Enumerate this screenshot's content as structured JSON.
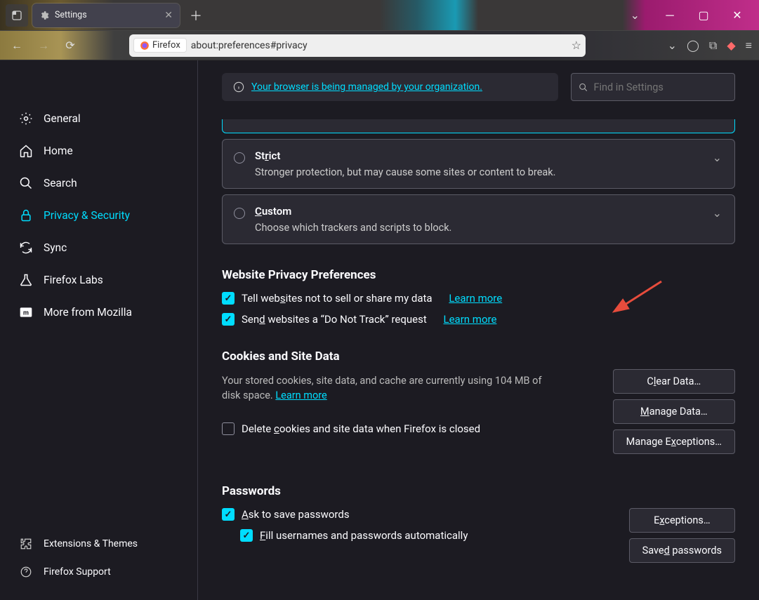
{
  "tab": {
    "title": "Settings"
  },
  "url": {
    "badge": "Firefox",
    "text": "about:preferences#privacy"
  },
  "banner": {
    "text": "Your browser is being managed by your organization."
  },
  "search": {
    "placeholder": "Find in Settings"
  },
  "sidebar": {
    "items": [
      {
        "label": "General"
      },
      {
        "label": "Home"
      },
      {
        "label": "Search"
      },
      {
        "label": "Privacy & Security"
      },
      {
        "label": "Sync"
      },
      {
        "label": "Firefox Labs"
      },
      {
        "label": "More from Mozilla"
      }
    ],
    "bottom": [
      {
        "label": "Extensions & Themes"
      },
      {
        "label": "Firefox Support"
      }
    ]
  },
  "tracking": {
    "strict": {
      "title_pre": "St",
      "title_u": "r",
      "title_post": "ict",
      "desc": "Stronger protection, but may cause some sites or content to break."
    },
    "custom": {
      "title_u": "C",
      "title_post": "ustom",
      "desc": "Choose which trackers and scripts to block."
    }
  },
  "privacy_prefs": {
    "heading": "Website Privacy Preferences",
    "opt1_pre": "Tell web",
    "opt1_u": "s",
    "opt1_post": "ites not to sell or share my data",
    "opt2_pre": "Sen",
    "opt2_u": "d",
    "opt2_post": " websites a “Do Not Track” request",
    "learn_more": "Learn more"
  },
  "cookies": {
    "heading": "Cookies and Site Data",
    "desc_pre": "Your stored cookies, site data, and cache are currently using 104 MB of disk space. ",
    "learn_more": "Learn more",
    "delete_pre": "Delete ",
    "delete_u": "c",
    "delete_post": "ookies and site data when Firefox is closed",
    "buttons": {
      "clear_pre": "C",
      "clear_u": "l",
      "clear_post": "ear Data…",
      "manage_u": "M",
      "manage_post": "anage Data…",
      "exc_pre": "Manage E",
      "exc_u": "x",
      "exc_post": "ceptions…"
    }
  },
  "passwords": {
    "heading": "Passwords",
    "ask_u": "A",
    "ask_post": "sk to save passwords",
    "fill_u": "F",
    "fill_post": "ill usernames and passwords automatically",
    "buttons": {
      "exc_pre": "E",
      "exc_u": "x",
      "exc_post": "ceptions…",
      "saved_pre": "Save",
      "saved_u": "d",
      "saved_post": " passwords"
    }
  }
}
